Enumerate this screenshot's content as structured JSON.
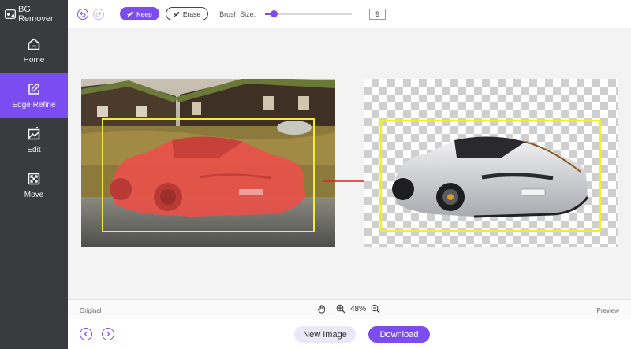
{
  "app": {
    "title": "BG Remover"
  },
  "sidebar": {
    "items": [
      {
        "label": "Home",
        "icon": "home-icon",
        "active": false
      },
      {
        "label": "Edge Refine",
        "icon": "edit-square-icon",
        "active": true
      },
      {
        "label": "Edit",
        "icon": "image-edit-icon",
        "active": false
      },
      {
        "label": "Move",
        "icon": "move-arrows-icon",
        "active": false
      }
    ]
  },
  "toolbar": {
    "keep_label": "Keep",
    "erase_label": "Erase",
    "brush_label": "Brush Size:",
    "brush_value": "9",
    "brush_level": 0.1
  },
  "canvas": {
    "left_label": "Original",
    "right_label": "Preview",
    "zoom": "48%"
  },
  "bottom": {
    "new_image_label": "New Image",
    "download_label": "Download"
  },
  "colors": {
    "accent": "#7b4cf0",
    "sidebar_bg": "#3a3b3f",
    "selection": "#f2ee2c",
    "arrow": "#e02020",
    "mask": "#e8504a"
  }
}
